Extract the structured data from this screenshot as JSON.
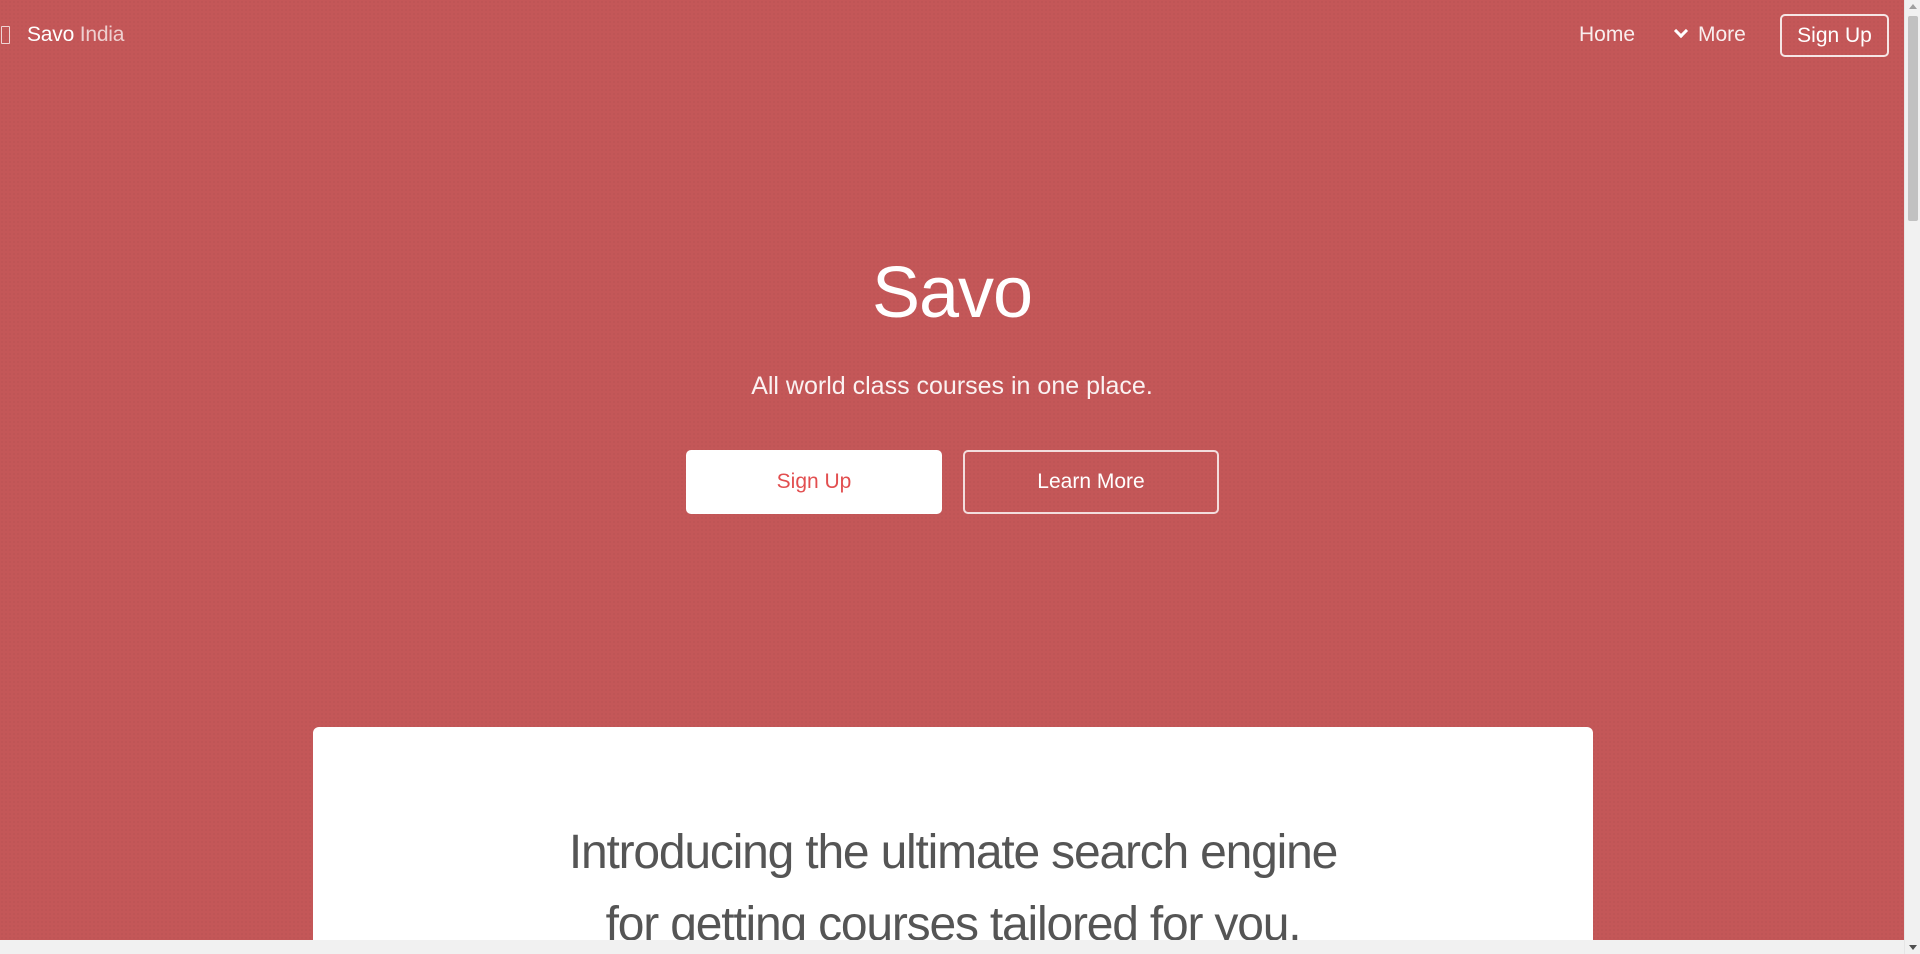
{
  "header": {
    "brand_main": "Savo",
    "brand_sub": "India",
    "nav": {
      "home": "Home",
      "more": "More",
      "signup": "Sign Up"
    }
  },
  "hero": {
    "title": "Savo",
    "subtitle": "All world class courses in one place.",
    "primary_button": "Sign Up",
    "secondary_button": "Learn More"
  },
  "card": {
    "heading_line1": "Introducing the ultimate search engine",
    "heading_line2": "for getting courses tailored for you."
  },
  "colors": {
    "background": "#c45758",
    "accent_text": "#e24f50",
    "card": "#ffffff"
  },
  "icons": {
    "menu": "menu-icon",
    "more": "chevron-down-icon"
  }
}
